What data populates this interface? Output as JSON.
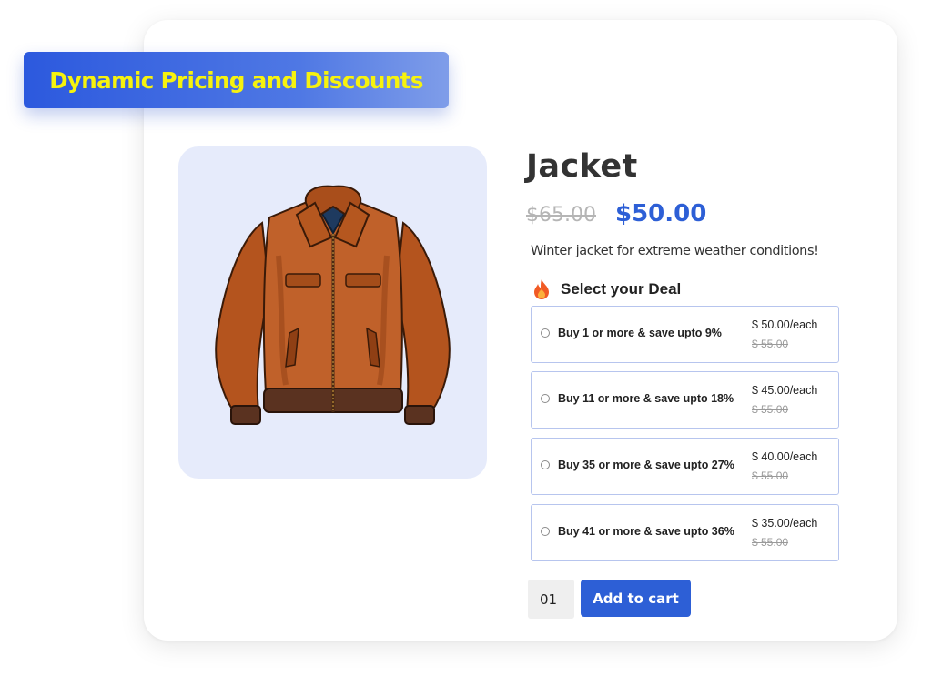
{
  "banner": {
    "text": "Dynamic Pricing and Discounts"
  },
  "product": {
    "title": "Jacket",
    "old_price": "$65.00",
    "price": "$50.00",
    "description": "Winter jacket for extreme weather conditions!",
    "image_icon": "leather-jacket"
  },
  "deals": {
    "heading": "Select your Deal",
    "heading_icon": "fire-emoji",
    "items": [
      {
        "label": "Buy 1 or more & save upto 9%",
        "price_each": "$ 50.00/each",
        "was": "$ 55.00"
      },
      {
        "label": "Buy 11 or more & save upto 18%",
        "price_each": "$ 45.00/each",
        "was": "$ 55.00"
      },
      {
        "label": "Buy 35 or more & save upto 27%",
        "price_each": "$ 40.00/each",
        "was": "$ 55.00"
      },
      {
        "label": "Buy 41 or more & save upto 36%",
        "price_each": "$ 35.00/each",
        "was": "$ 55.00"
      }
    ]
  },
  "cart": {
    "quantity": "01",
    "add_label": "Add to cart"
  },
  "colors": {
    "accent": "#2d5fd6",
    "banner_text": "#f6f20e",
    "image_bg": "#e6ebfb",
    "deal_border": "#b7c5ee"
  }
}
